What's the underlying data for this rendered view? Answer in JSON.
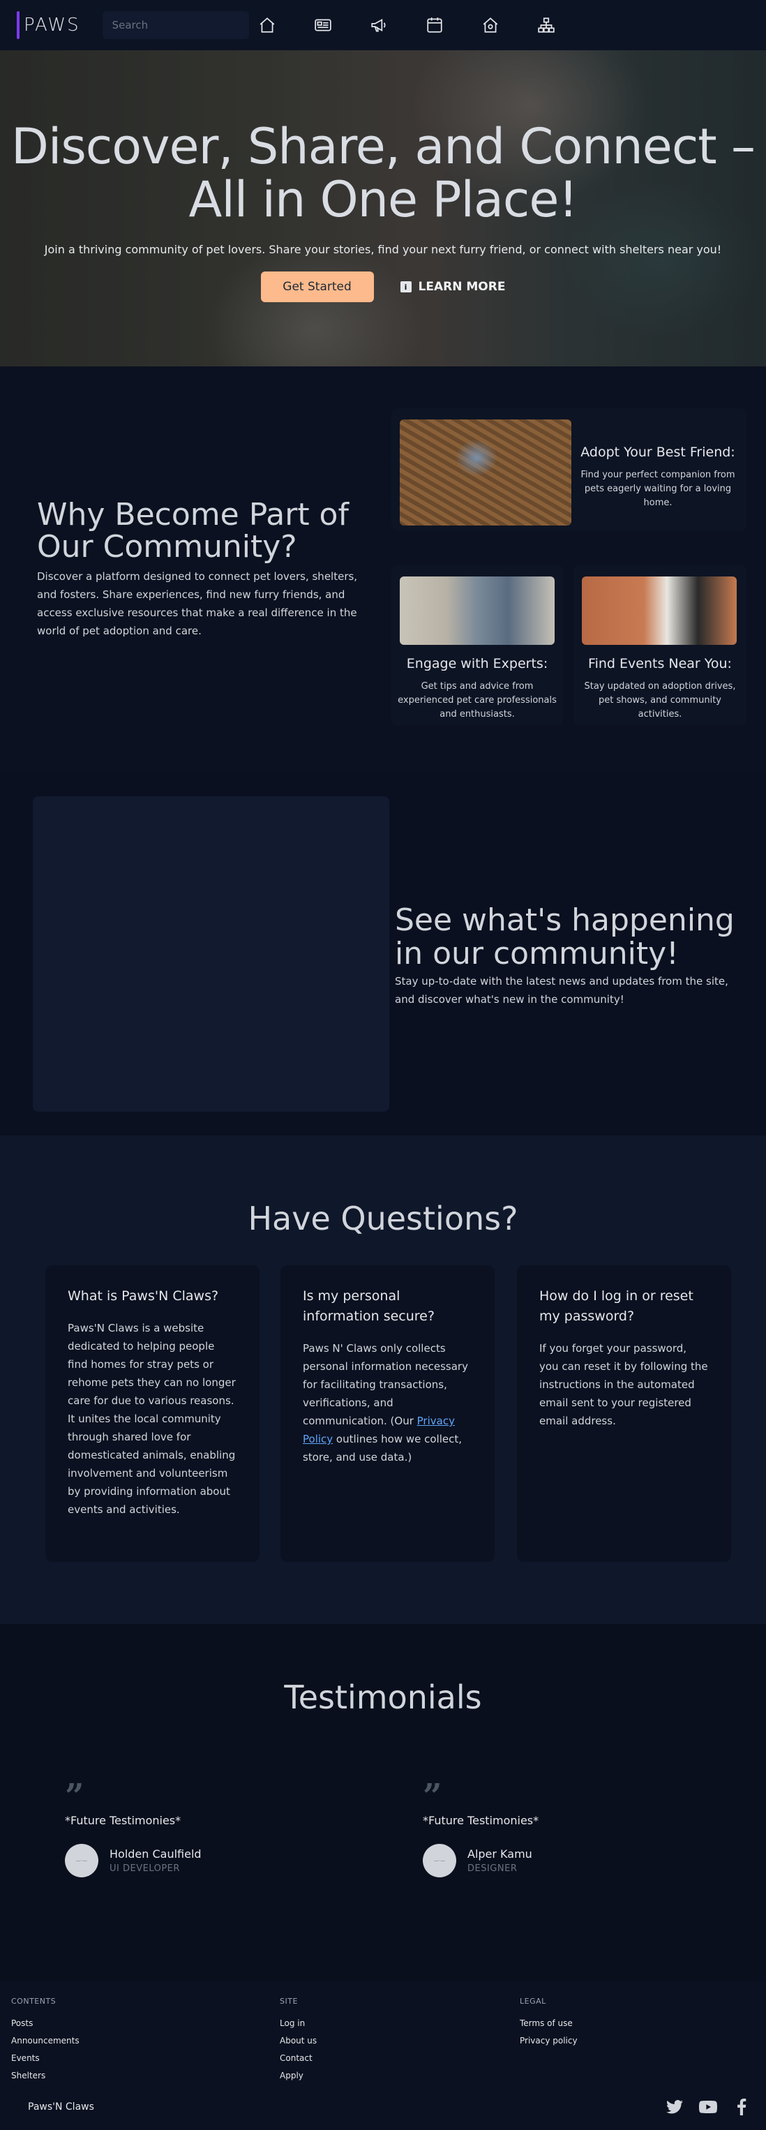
{
  "nav": {
    "logo": "PAWS",
    "search_placeholder": "Search",
    "icons": [
      "home-icon",
      "newspaper-icon",
      "megaphone-icon",
      "calendar-icon",
      "shelter-icon",
      "sitemap-icon"
    ]
  },
  "hero": {
    "title": "Discover, Share, and Connect – All in One Place!",
    "subtitle": "Join a thriving community of pet lovers. Share your stories, find your next furry friend, or connect with shelters near you!",
    "cta_primary": "Get Started",
    "cta_secondary": "LEARN MORE"
  },
  "why": {
    "title": "Why Become Part of Our Community?",
    "body": "Discover a platform designed to connect pet lovers, shelters, and fosters. Share experiences, find new furry friends, and access exclusive resources that make a real difference in the world of pet adoption and care.",
    "cards": [
      {
        "title": "Adopt Your Best Friend:",
        "text": "Find your perfect companion from pets eagerly waiting for a loving home."
      },
      {
        "title": "Engage with Experts:",
        "text": "Get tips and advice from experienced pet care professionals and enthusiasts."
      },
      {
        "title": "Find Events Near You:",
        "text": "Stay updated on adoption drives, pet shows, and community activities."
      }
    ]
  },
  "happening": {
    "title": "See what's happening in our community!",
    "body": "Stay up-to-date with the latest news and updates from the site, and discover what's new in the community!"
  },
  "faq": {
    "title": "Have Questions?",
    "items": [
      {
        "q": "What is Paws'N Claws?",
        "a": "Paws'N Claws is a website dedicated to helping people find homes for stray pets or rehome pets they can no longer care for due to various reasons. It unites the local community through shared love for domesticated animals, enabling involvement and volunteerism by providing information about events and activities."
      },
      {
        "q": "Is my personal information secure?",
        "a_before": "Paws N' Claws only collects personal information necessary for facilitating transactions, verifications, and communication. (Our ",
        "a_link": "Privacy Policy",
        "a_after": " outlines how we collect, store, and use data.)"
      },
      {
        "q": "How do I log in or reset my password?",
        "a": "If you forget your password, you can reset it by following the instructions in the automated email sent to your registered email address."
      }
    ]
  },
  "testimonials": {
    "title": "Testimonials",
    "items": [
      {
        "quote": "*Future Testimonies*",
        "name": "Holden Caulfield",
        "role": "UI DEVELOPER"
      },
      {
        "quote": "*Future Testimonies*",
        "name": "Alper Kamu",
        "role": "DESIGNER"
      }
    ]
  },
  "footer": {
    "cols": [
      {
        "heading": "CONTENTS",
        "links": [
          "Posts",
          "Announcements",
          "Events",
          "Shelters"
        ]
      },
      {
        "heading": "SITE",
        "links": [
          "Log in",
          "About us",
          "Contact",
          "Apply"
        ]
      },
      {
        "heading": "LEGAL",
        "links": [
          "Terms of use",
          "Privacy policy"
        ]
      }
    ],
    "brand": "Paws'N Claws",
    "socials": [
      "twitter-icon",
      "youtube-icon",
      "facebook-icon"
    ]
  },
  "colors": {
    "accent": "#7c3aed",
    "cta": "#fdba8c",
    "link": "#60a5fa",
    "background": "#0b1120"
  }
}
